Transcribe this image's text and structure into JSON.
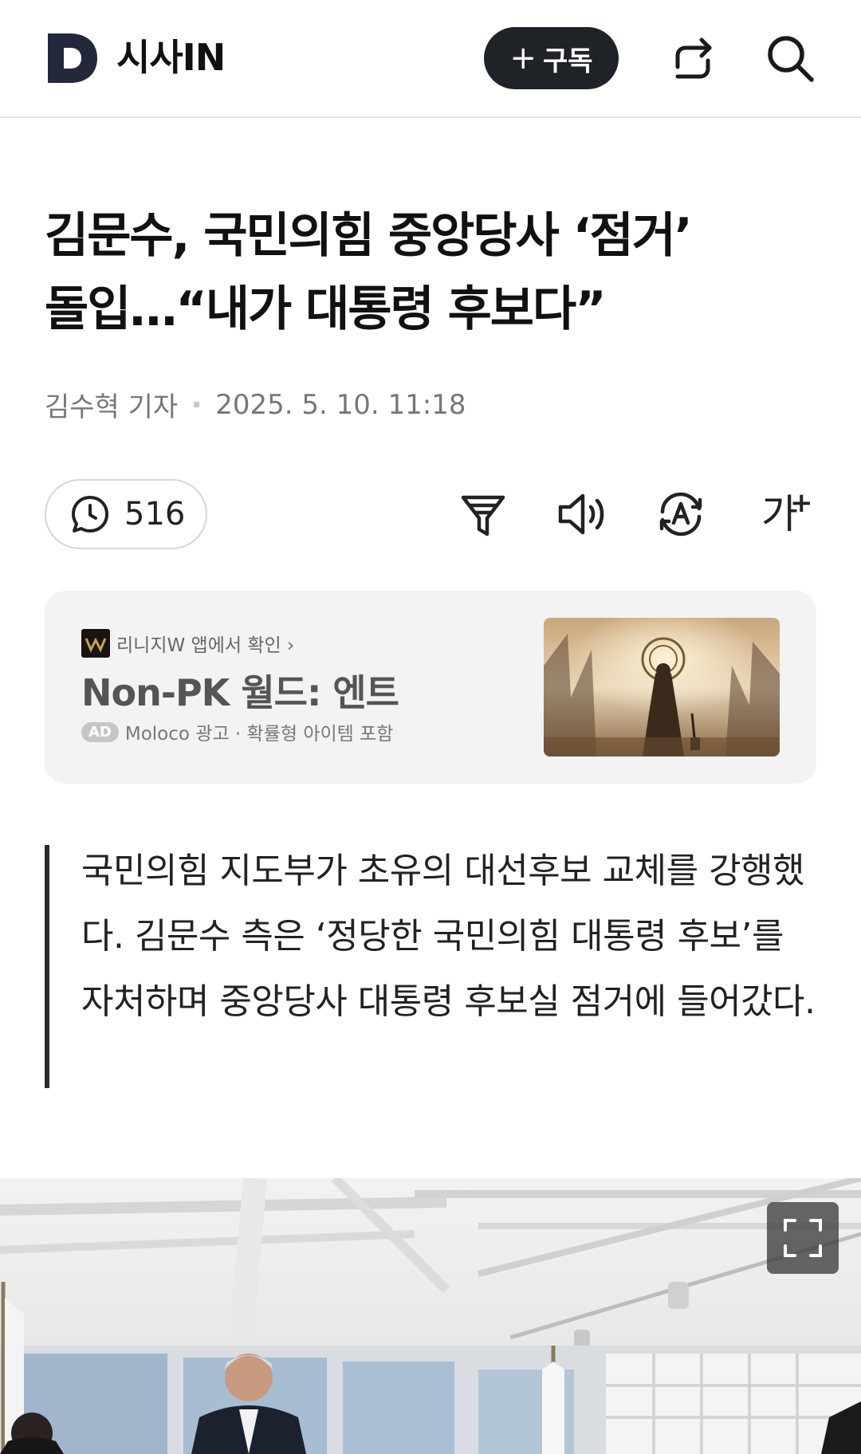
{
  "header": {
    "brand": "시사IN",
    "subscribe_label": "구독",
    "subscribe_plus": "+",
    "share_icon": "share-icon",
    "search_icon": "search-icon"
  },
  "article": {
    "title_line1": "김문수, 국민의힘 중앙당사 ‘점거’",
    "title_line2": "돌입…“내가 대통령 후보다”",
    "author": "김수혁 기자",
    "date": "2025. 5. 10. 11:18",
    "summary": "국민의힘 지도부가 초유의 대선후보 교체를 강행했다. 김문수 측은 ‘정당한 국민의힘 대통령 후보’를 자처하며 중앙당사 대통령 후보실 점거에 들어갔다."
  },
  "toolbar": {
    "comment_count": "516",
    "icons": [
      "comment-icon",
      "filter-icon",
      "speaker-icon",
      "translate-icon",
      "font-size-icon"
    ],
    "font_size_label": "가"
  },
  "ad": {
    "source": "리니지W 앱에서 확인 ›",
    "title": "Non-PK 월드: 엔트",
    "badge": "AD",
    "meta": "Moloco 광고 · 확률형 아이템 포함"
  },
  "colors": {
    "brand_dark": "#1f2328",
    "logo_navy": "#23283a",
    "text_gray": "#777777",
    "ad_bg": "#f3f3f3"
  }
}
